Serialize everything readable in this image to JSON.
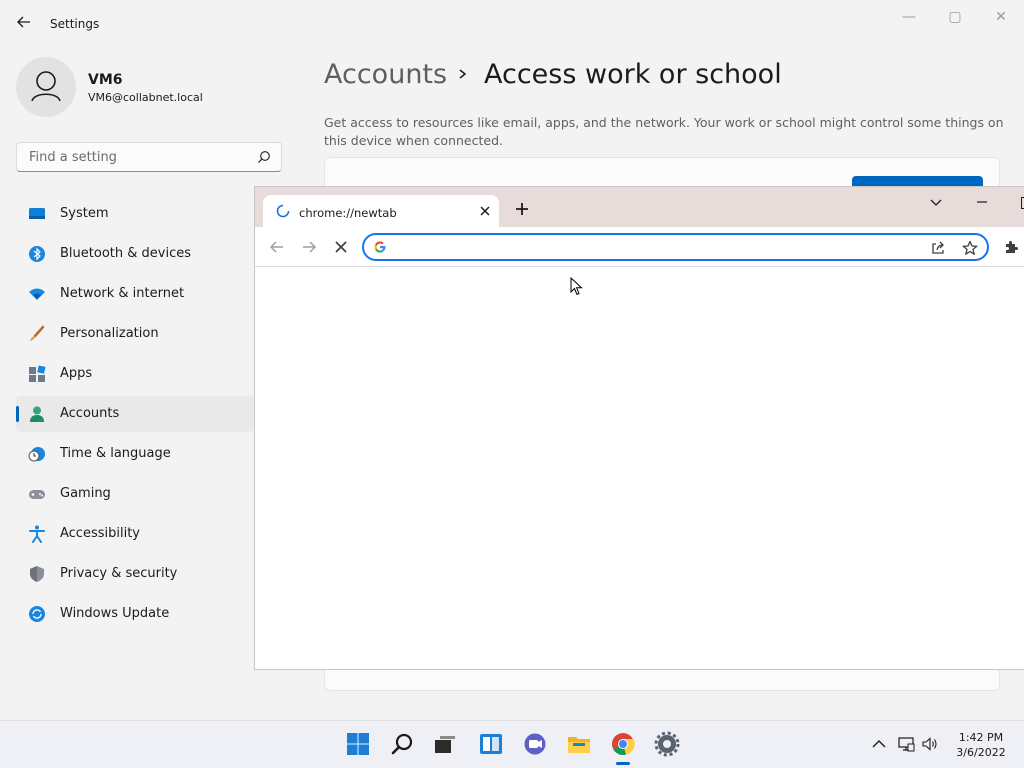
{
  "settings_window": {
    "title": "Settings",
    "controls": {
      "minimize": "—",
      "maximize": "▢",
      "close": "✕"
    },
    "account": {
      "name": "VM6",
      "email": "VM6@collabnet.local"
    },
    "search": {
      "placeholder": "Find a setting",
      "value": ""
    },
    "nav": {
      "items": [
        {
          "label": "System",
          "icon": "system-icon"
        },
        {
          "label": "Bluetooth & devices",
          "icon": "bluetooth-icon"
        },
        {
          "label": "Network & internet",
          "icon": "network-icon"
        },
        {
          "label": "Personalization",
          "icon": "brush-icon"
        },
        {
          "label": "Apps",
          "icon": "apps-icon"
        },
        {
          "label": "Accounts",
          "icon": "accounts-icon",
          "active": true
        },
        {
          "label": "Time & language",
          "icon": "clock-globe-icon"
        },
        {
          "label": "Gaming",
          "icon": "gamepad-icon"
        },
        {
          "label": "Accessibility",
          "icon": "accessibility-icon"
        },
        {
          "label": "Privacy & security",
          "icon": "shield-icon"
        },
        {
          "label": "Windows Update",
          "icon": "update-icon"
        }
      ]
    },
    "breadcrumb": {
      "parent": "Accounts",
      "current": "Access work or school"
    },
    "description": "Get access to resources like email, apps, and the network. Your work or school might control some things on this device when connected."
  },
  "chrome_window": {
    "tab": {
      "title": "chrome://newtab"
    },
    "omnibox": {
      "value": "",
      "placeholder": ""
    }
  },
  "taskbar": {
    "apps": [
      "start-icon",
      "search-icon",
      "task-view-icon",
      "widgets-icon",
      "chat-icon",
      "file-explorer-icon",
      "chrome-icon",
      "settings-icon"
    ],
    "clock": {
      "time": "1:42 PM",
      "date": "3/6/2022"
    }
  },
  "colors": {
    "accent": "#0067c0",
    "chrome_tabstrip": "#e8dcdb",
    "focus_ring": "#1a73e8"
  }
}
